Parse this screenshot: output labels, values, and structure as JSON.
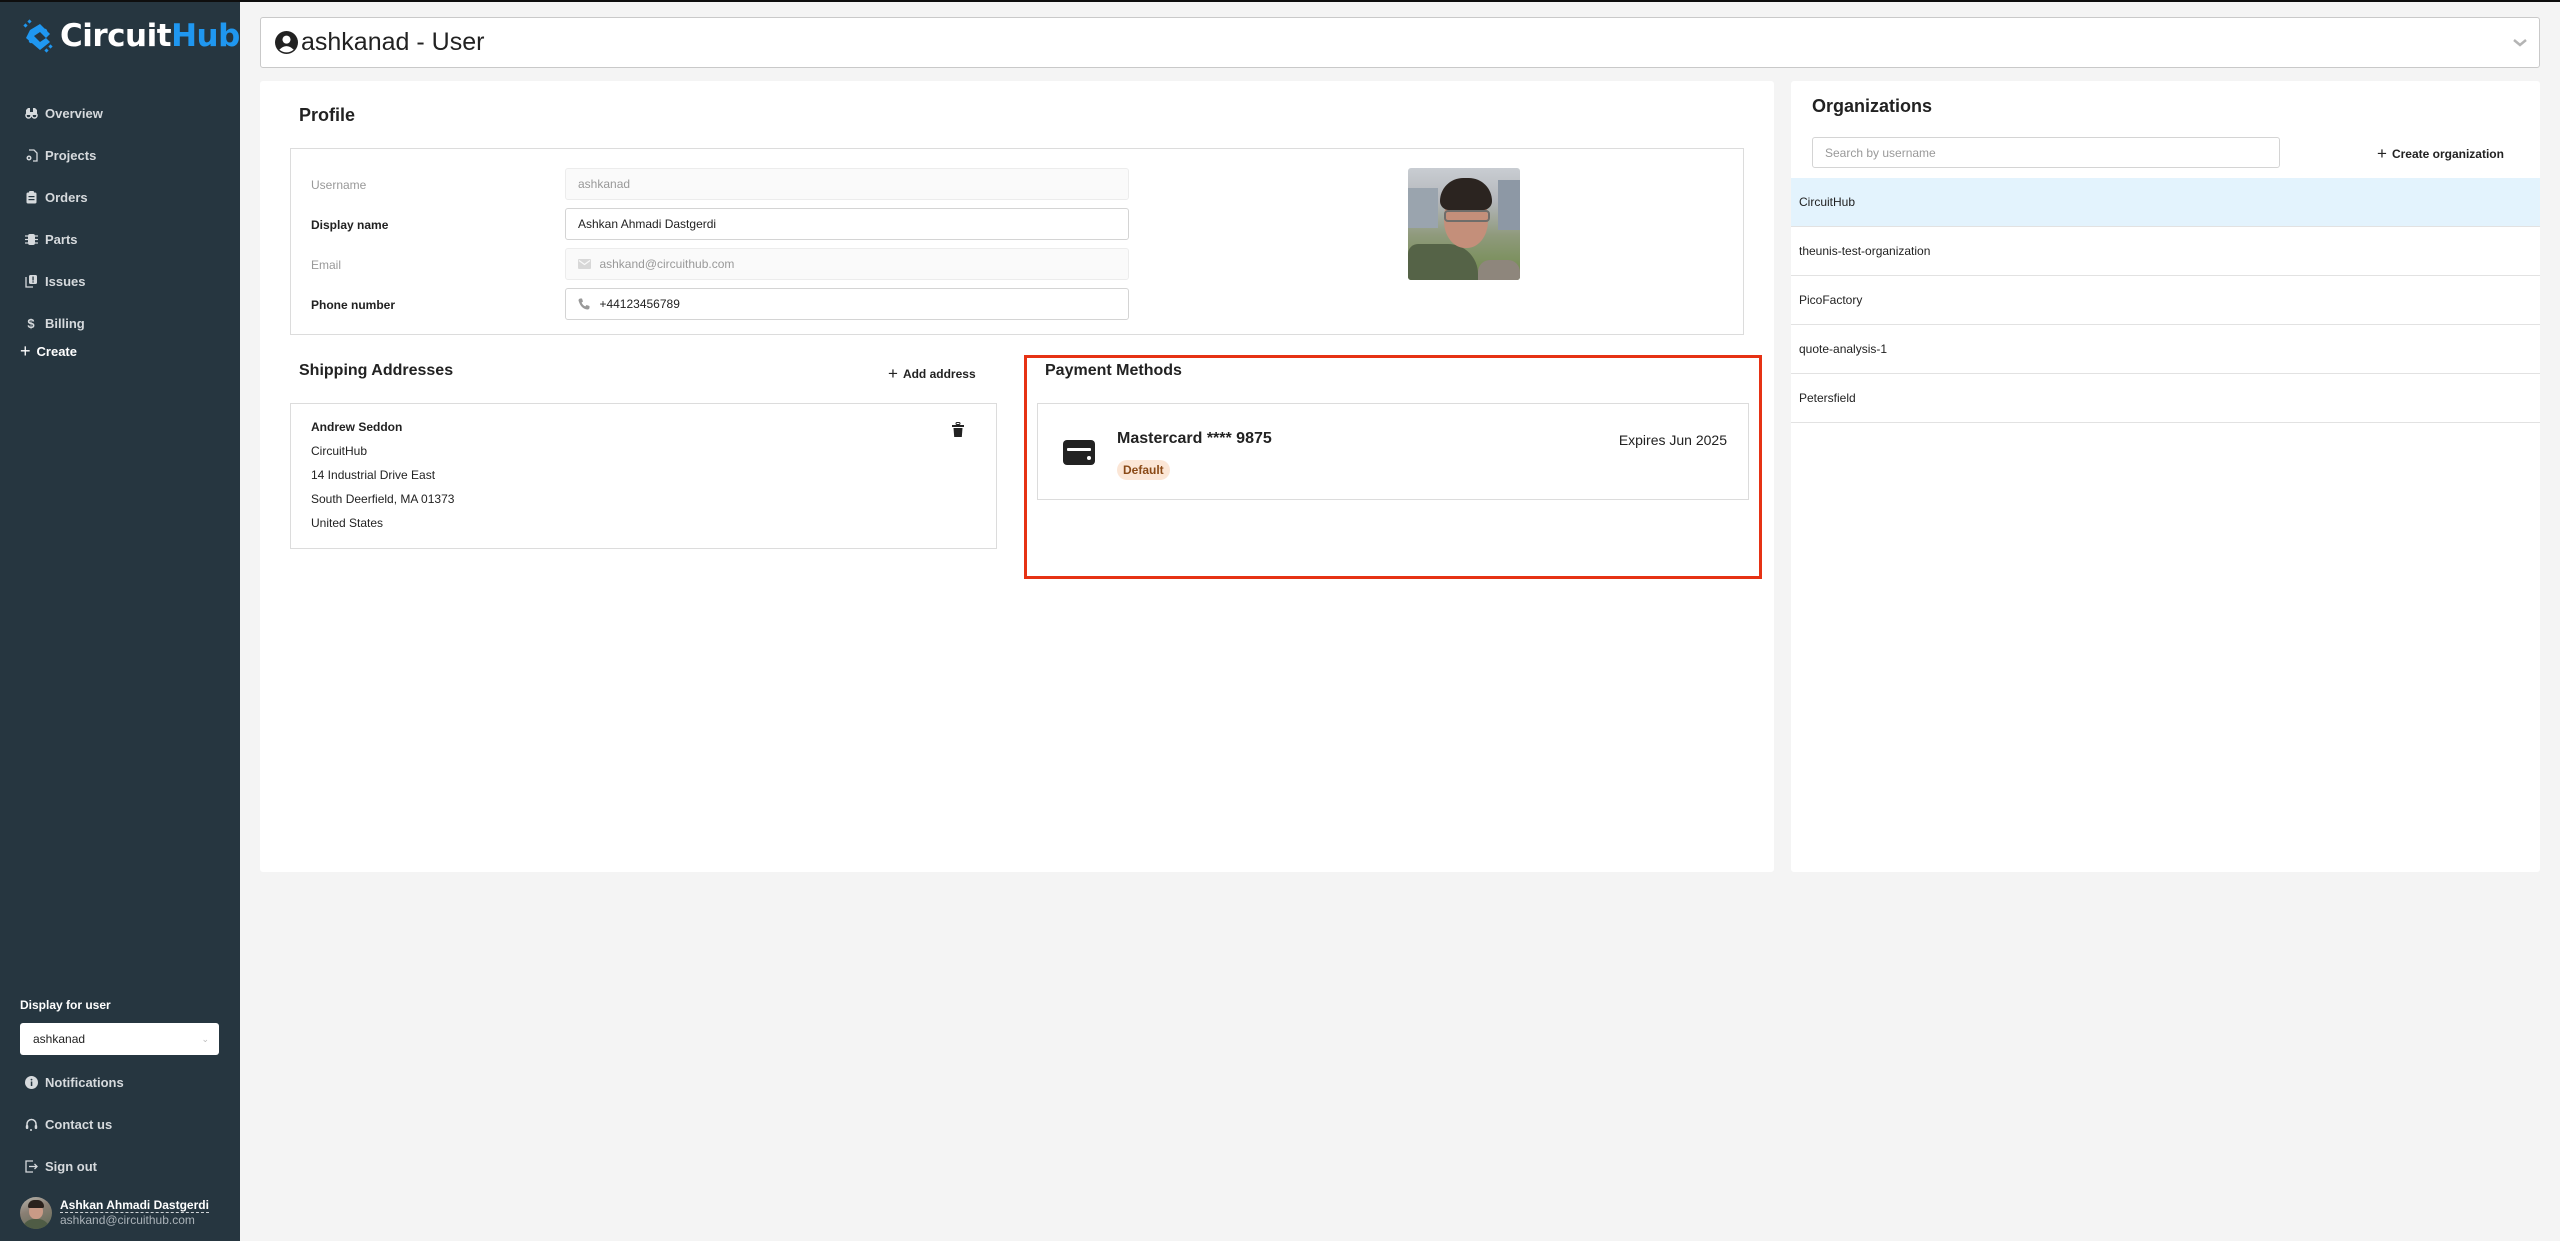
{
  "app": {
    "brand_part1": "Circuit",
    "brand_part2": "Hub",
    "brand_color": "#1f97f0",
    "sidebar_bg": "#263640"
  },
  "sidebar": {
    "nav": [
      {
        "label": "Overview",
        "icon": "binoculars-icon"
      },
      {
        "label": "Projects",
        "icon": "project-gear-icon"
      },
      {
        "label": "Orders",
        "icon": "clipboard-icon"
      },
      {
        "label": "Parts",
        "icon": "chip-icon"
      },
      {
        "label": "Issues",
        "icon": "issue-icon"
      },
      {
        "label": "Billing",
        "icon": "dollar-icon"
      }
    ],
    "create_label": "Create",
    "display_for_user_label": "Display for user",
    "display_for_user_value": "ashkanad",
    "bottom_nav": [
      {
        "label": "Notifications",
        "icon": "info-icon"
      },
      {
        "label": "Contact us",
        "icon": "headset-icon"
      },
      {
        "label": "Sign out",
        "icon": "sign-out-icon"
      }
    ],
    "user": {
      "name": "Ashkan Ahmadi Dastgerdi",
      "email": "ashkand@circuithub.com"
    }
  },
  "header": {
    "title": "ashkanad - User"
  },
  "profile": {
    "title": "Profile",
    "fields": {
      "username": {
        "label": "Username",
        "value": "ashkanad"
      },
      "display_name": {
        "label": "Display name",
        "value": "Ashkan Ahmadi Dastgerdi"
      },
      "email": {
        "label": "Email",
        "value": "ashkand@circuithub.com"
      },
      "phone": {
        "label": "Phone number",
        "value": "+44123456789"
      }
    }
  },
  "shipping": {
    "title": "Shipping Addresses",
    "add_label": "Add address",
    "addresses": [
      {
        "name": "Andrew Seddon",
        "company": "CircuitHub",
        "street": "14 Industrial Drive East",
        "city_line": "South Deerfield, MA 01373",
        "country": "United States"
      }
    ]
  },
  "payment": {
    "title": "Payment Methods",
    "highlight_color": "#e63214",
    "methods": [
      {
        "name": "Mastercard **** 9875",
        "expiry": "Expires Jun 2025",
        "badge": "Default"
      }
    ]
  },
  "organizations": {
    "title": "Organizations",
    "search_placeholder": "Search by username",
    "search_value": "",
    "create_label": "Create organization",
    "items": [
      {
        "name": "CircuitHub",
        "selected": true
      },
      {
        "name": "theunis-test-organization",
        "selected": false
      },
      {
        "name": "PicoFactory",
        "selected": false
      },
      {
        "name": "quote-analysis-1",
        "selected": false
      },
      {
        "name": "Petersfield",
        "selected": false
      }
    ]
  }
}
